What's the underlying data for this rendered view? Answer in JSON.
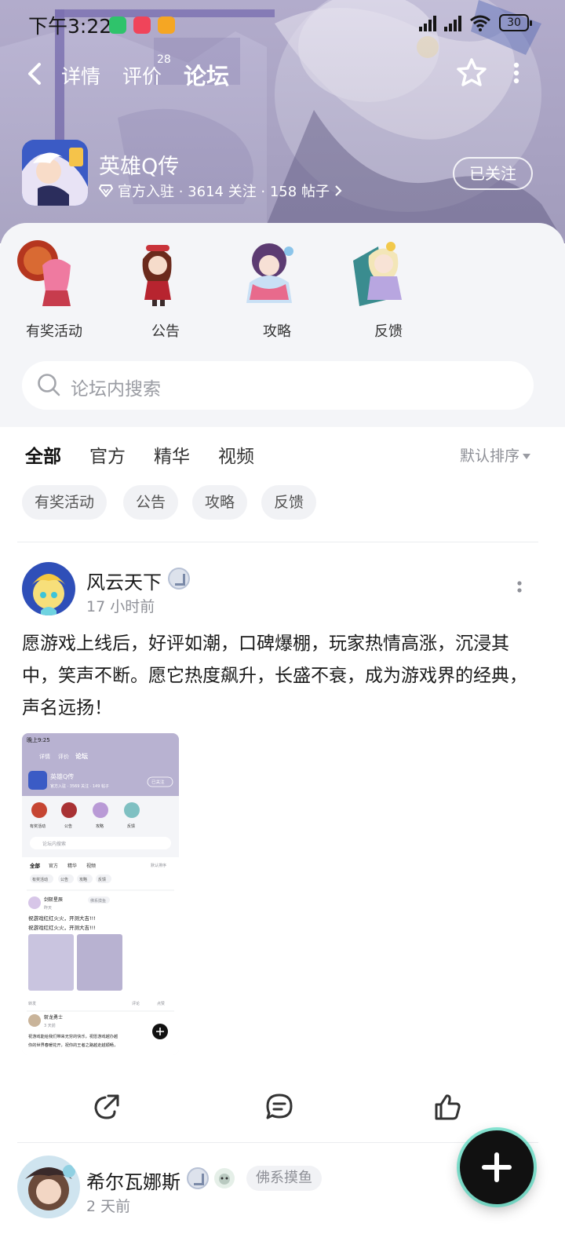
{
  "status_bar": {
    "time": "下午3:22",
    "battery": "30"
  },
  "nav": {
    "tabs": [
      {
        "label": "详情",
        "active": false
      },
      {
        "label": "评价",
        "active": false,
        "badge": "28"
      },
      {
        "label": "论坛",
        "active": true
      }
    ]
  },
  "game": {
    "name": "英雄Q传",
    "meta": "官方入驻 · 3614 关注 · 158 帖子",
    "follow_label": "已关注"
  },
  "categories": [
    {
      "label": "有奖活动"
    },
    {
      "label": "公告"
    },
    {
      "label": "攻略"
    },
    {
      "label": "反馈"
    }
  ],
  "search": {
    "placeholder": "论坛内搜索"
  },
  "filter_tabs": [
    {
      "label": "全部",
      "active": true
    },
    {
      "label": "官方"
    },
    {
      "label": "精华"
    },
    {
      "label": "视频"
    }
  ],
  "sort_label": "默认排序",
  "chips": [
    "有奖活动",
    "公告",
    "攻略",
    "反馈"
  ],
  "posts": [
    {
      "author": "风云天下",
      "time": "17 小时前",
      "content": "愿游戏上线后，好评如潮，口碑爆棚，玩家热情高涨，沉浸其中，笑声不断。愿它热度飙升，长盛不衰，成为游戏界的经典，声名远扬！",
      "screenshot": {
        "time": "晚上9:25",
        "tabs": [
          "详情",
          "评价",
          "论坛"
        ],
        "game_name": "英雄Q传",
        "game_meta": "官方入驻 · 3569 关注 · 149 帖子",
        "follow_label": "已关注",
        "categories": [
          "有奖活动",
          "公告",
          "攻略",
          "反馈"
        ],
        "search": "论坛内搜索",
        "filter_tabs": [
          "全部",
          "官方",
          "精华",
          "视频"
        ],
        "sort_label": "默认排序",
        "chips": [
          "有奖活动",
          "公告",
          "攻略",
          "反馈"
        ],
        "post_author": "剑斩星辰",
        "post_tag": "佛系摸鱼",
        "post_time": "昨天",
        "post_lines": [
          "祝游戏红红火火，开测大吉!!!",
          "祝游戏红红火火，开测大吉!!!"
        ],
        "post_footer": [
          "转发",
          "评论",
          "点赞"
        ],
        "post2_author": "斩龙勇士",
        "post2_time": "3 天前",
        "post2_lines": [
          "祝游戏能给我们带来无穷的快乐，祝愿游戏越办越",
          "你的世界春暖花开，祝你的王者之路越走越顺畅，"
        ]
      }
    },
    {
      "author": "希尔瓦娜斯",
      "time": "2 天前",
      "tag": "佛系摸鱼"
    }
  ],
  "colors": {
    "accent": "#28d3b2",
    "header_bg": "#b7b1cf",
    "sheet_bg": "#f4f5f8"
  }
}
